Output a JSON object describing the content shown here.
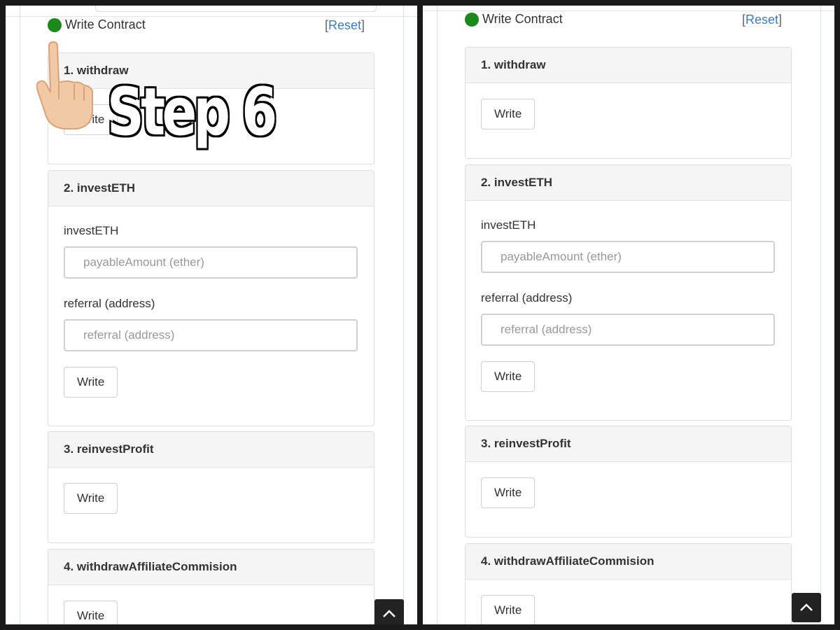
{
  "header": {
    "title": "Write Contract",
    "reset_open": "[",
    "reset_link": "Reset",
    "reset_close": "]",
    "status_color": "#1b8a1b"
  },
  "overlay": {
    "step_text": "Step 6"
  },
  "functions": [
    {
      "title": "1. withdraw",
      "button": "Write"
    },
    {
      "title": "2. investETH",
      "fields": [
        {
          "label": "investETH",
          "placeholder": "payableAmount (ether)"
        },
        {
          "label": "referral (address)",
          "placeholder": "referral (address)"
        }
      ],
      "button": "Write"
    },
    {
      "title": "3. reinvestProfit",
      "button": "Write"
    },
    {
      "title": "4. withdrawAffiliateCommision",
      "button": "Write"
    }
  ],
  "icons": {
    "scroll_top": "chevron-up-icon",
    "pointer": "pointing-hand-icon"
  }
}
